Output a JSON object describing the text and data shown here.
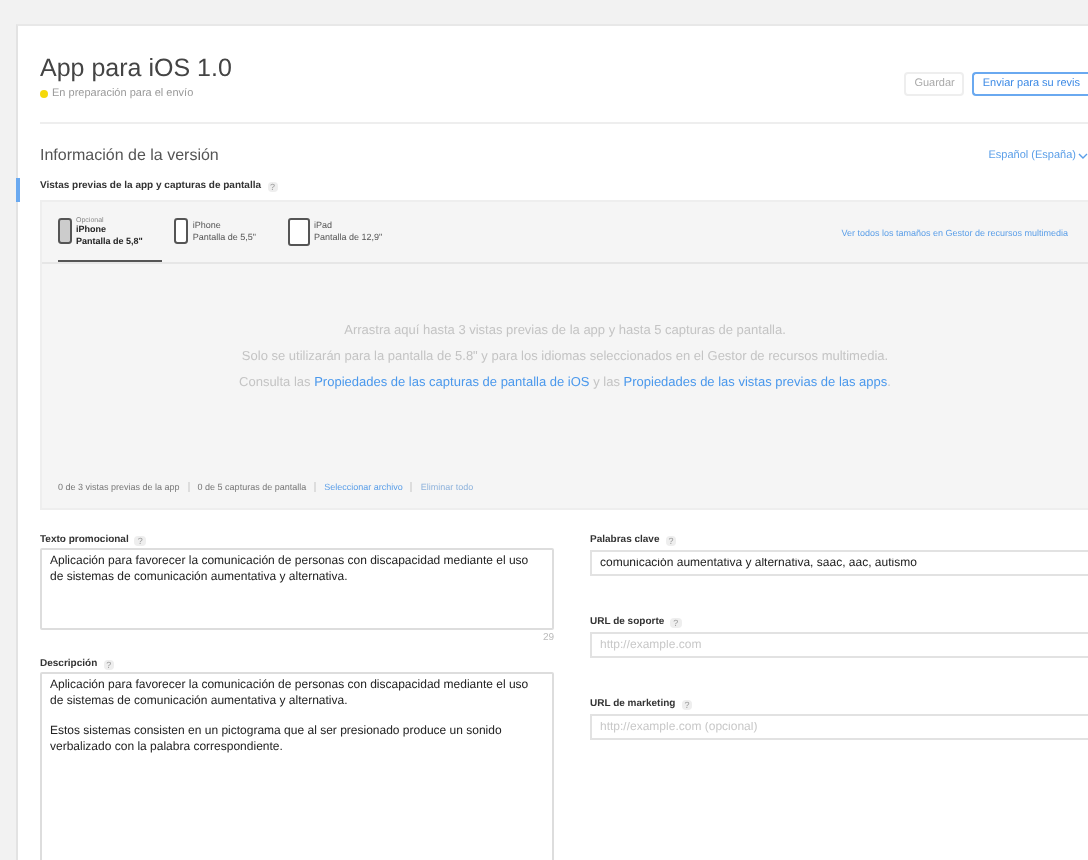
{
  "header": {
    "title": "App para iOS 1.0",
    "status": {
      "text": "En preparación para el envío",
      "color": "#f5d90a"
    }
  },
  "buttons": [
    {
      "label": "Guardar",
      "disabled": true
    },
    {
      "label": "Enviar para su revis",
      "disabled": false
    }
  ],
  "section": {
    "title": "Información de la versión",
    "language": "Español (España)"
  },
  "media": {
    "label": "Vistas previas de la app y capturas de pantalla",
    "help": "?",
    "devices": [
      {
        "note": "Opcional",
        "name": "iPhone",
        "size": "Pantalla de 5,8\"",
        "kind": "phone",
        "selected": true
      },
      {
        "name": "iPhone",
        "size": "Pantalla de 5,5\"",
        "kind": "phone",
        "selected": false
      },
      {
        "name": "iPad",
        "size": "Pantalla de 12,9\"",
        "kind": "tablet",
        "selected": false
      }
    ],
    "all_sizes_link": "Ver todos los tamaños en Gestor de recursos multimedia",
    "drop_lines": [
      [
        {
          "kind": "text",
          "text": "Arrastra aquí hasta 3 vistas previas de la app y hasta 5 capturas de pantalla."
        }
      ],
      [
        {
          "kind": "text",
          "text": "Solo se utilizarán para la pantalla de 5.8\" y para los idiomas seleccionados en el Gestor de recursos multimedia."
        }
      ],
      [
        {
          "kind": "text",
          "text": "Consulta las "
        },
        {
          "kind": "link",
          "text": "Propiedades de las capturas de pantalla de iOS"
        },
        {
          "kind": "text",
          "text": " y las "
        },
        {
          "kind": "link",
          "text": "Propiedades de las vistas previas de las apps"
        },
        {
          "kind": "text",
          "text": "."
        }
      ]
    ],
    "counts": [
      "0 de 3 vistas previas de la app",
      "0 de 5 capturas de pantalla"
    ],
    "actions": [
      {
        "label": "Seleccionar archivo",
        "disabled": false
      },
      {
        "label": "Eliminar todo",
        "disabled": true
      }
    ]
  },
  "left_fields": [
    {
      "label": "Texto promocional",
      "help": "?",
      "value": "Aplicación para favorecer la comunicación de personas con discapacidad mediante el uso de sistemas de comunicación aumentativa y alternativa.",
      "counter": "29",
      "kind": "short"
    },
    {
      "label": "Descripción",
      "help": "?",
      "value": "Aplicación para favorecer la comunicación de personas con discapacidad mediante el uso de sistemas de comunicación aumentativa y alternativa.\n\nEstos sistemas consisten en un pictograma que al ser presionado produce un sonido verbalizado con la palabra correspondiente.",
      "kind": "long"
    }
  ],
  "right_fields": [
    {
      "label": "Palabras clave",
      "help": "?",
      "value": "comunicación aumentativa y alternativa, saac, aac, autismo"
    },
    {
      "label": "URL de soporte",
      "help": "?",
      "placeholder": "http://example.com"
    },
    {
      "label": "URL de marketing",
      "help": "?",
      "placeholder": "http://example.com (opcional)"
    }
  ]
}
